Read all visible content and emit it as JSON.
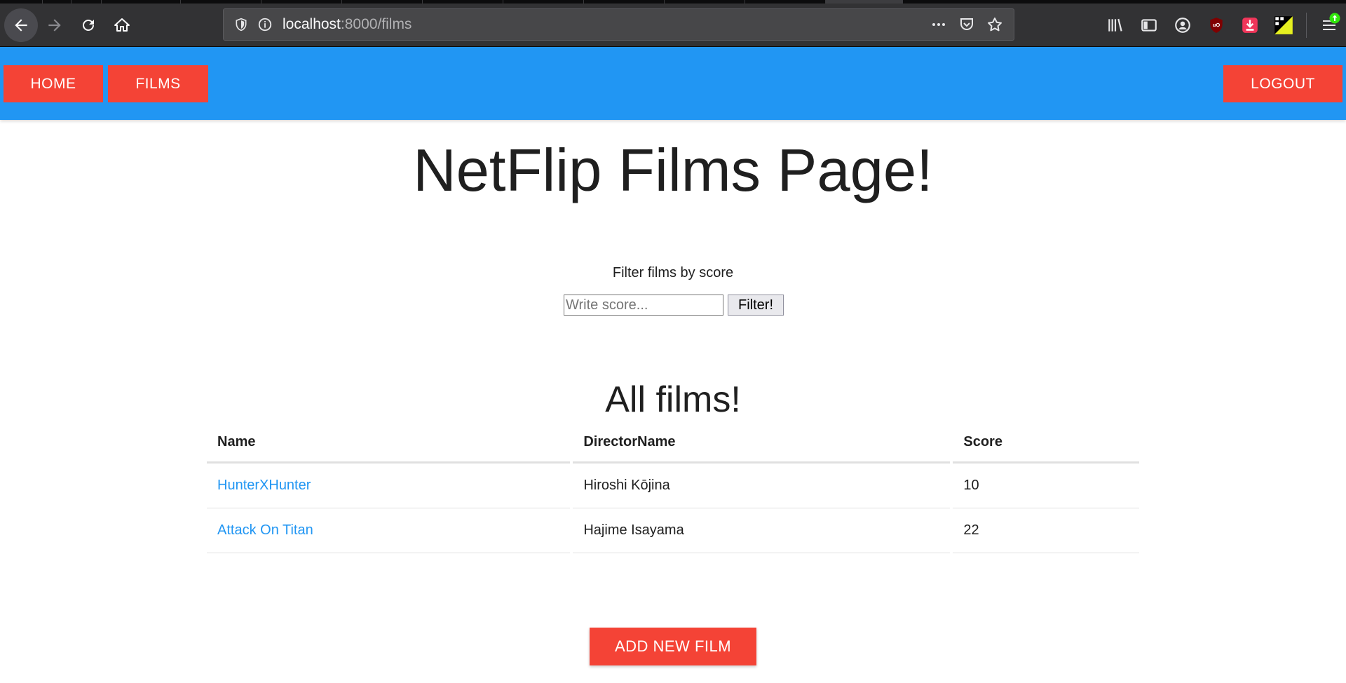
{
  "browser": {
    "url_host": "localhost",
    "url_rest": ":8000/films"
  },
  "nav": {
    "home_label": "HOME",
    "films_label": "FILMS",
    "logout_label": "LOGOUT",
    "bar_color": "#2196f3",
    "button_color": "#f44336"
  },
  "page": {
    "title": "NetFlip Films Page!",
    "filter_label": "Filter films by score",
    "filter_placeholder": "Write score...",
    "filter_button": "Filter!",
    "section_title": "All films!",
    "add_button": "ADD NEW FILM"
  },
  "table": {
    "headers": [
      "Name",
      "DirectorName",
      "Score"
    ],
    "rows": [
      {
        "name": "HunterXHunter",
        "director": "Hiroshi Kōjina",
        "score": "10"
      },
      {
        "name": "Attack On Titan",
        "director": "Hajime Isayama",
        "score": "22"
      }
    ]
  },
  "icons": {
    "back": "arrow-left-icon",
    "forward": "arrow-right-icon",
    "reload": "reload-icon",
    "home": "home-icon",
    "shield": "shield-icon",
    "info": "info-icon",
    "more": "more-icon",
    "pocket": "pocket-icon",
    "star": "star-icon",
    "library": "library-icon",
    "sidebar": "sidebar-icon",
    "account": "account-icon",
    "ublock": "ublock-icon",
    "download": "download-icon",
    "extension": "extension-icon",
    "menu": "hamburger-menu-icon"
  }
}
